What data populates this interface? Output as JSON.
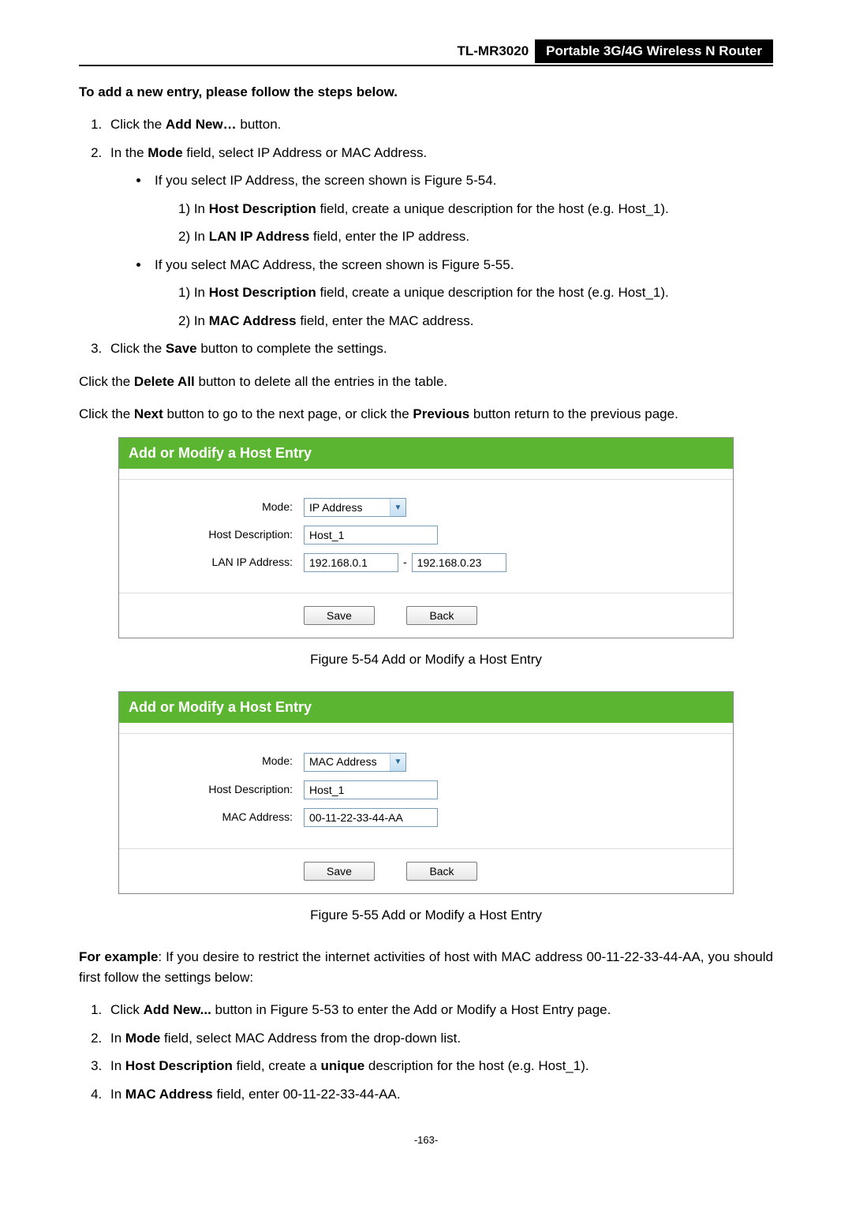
{
  "header": {
    "model": "TL-MR3020",
    "product": "Portable 3G/4G Wireless N Router"
  },
  "intro": "To add a new entry, please follow the steps below.",
  "step1_a": "Click the ",
  "step1_b": "Add New…",
  "step1_c": " button.",
  "step2_a": "In the ",
  "step2_b": "Mode",
  "step2_c": " field, select IP Address or MAC Address.",
  "bullet_ip": "If you select IP Address, the screen shown is Figure 5-54.",
  "ip_1a": "1)  In ",
  "ip_1b": "Host Description",
  "ip_1c": " field, create a unique description for the host (e.g. Host_1).",
  "ip_2a": "2)  In ",
  "ip_2b": "LAN IP Address",
  "ip_2c": " field, enter the IP address.",
  "bullet_mac": "If you select MAC Address, the screen shown is Figure 5-55.",
  "mac_1a": "1)  In ",
  "mac_1b": "Host Description",
  "mac_1c": " field, create a unique description for the host (e.g. Host_1).",
  "mac_2a": "2)  In ",
  "mac_2b": "MAC Address",
  "mac_2c": " field, enter the MAC address.",
  "step3_a": "Click the ",
  "step3_b": "Save",
  "step3_c": " button to complete the settings.",
  "p_delete_a": "Click the ",
  "p_delete_b": "Delete All",
  "p_delete_c": " button to delete all the entries in the table.",
  "p_next_a": "Click the ",
  "p_next_b": "Next",
  "p_next_c": " button to go to the next page, or click the ",
  "p_next_d": "Previous",
  "p_next_e": " button return to the previous page.",
  "fig54": {
    "title": "Add or Modify a Host Entry",
    "labels": {
      "mode": "Mode:",
      "host": "Host Description:",
      "lan": "LAN IP Address:"
    },
    "mode_value": "IP Address",
    "host_value": "Host_1",
    "ip_start": "192.168.0.1",
    "ip_end": "192.168.0.23",
    "save": "Save",
    "back": "Back",
    "caption": "Figure 5-54    Add or Modify a Host Entry"
  },
  "fig55": {
    "title": "Add or Modify a Host Entry",
    "labels": {
      "mode": "Mode:",
      "host": "Host Description:",
      "mac": "MAC Address:"
    },
    "mode_value": "MAC Address",
    "host_value": "Host_1",
    "mac_value": "00-11-22-33-44-AA",
    "save": "Save",
    "back": "Back",
    "caption": "Figure 5-55    Add or Modify a Host Entry"
  },
  "example_a": "For example",
  "example_b": ": If you desire to restrict the internet activities of host with MAC address 00-11-22-33-44-AA, you should first follow the settings below:",
  "ex1_a": "Click ",
  "ex1_b": "Add New...",
  "ex1_c": " button in Figure 5-53 to enter the Add or Modify a Host Entry page.",
  "ex2_a": "In ",
  "ex2_b": "Mode",
  "ex2_c": " field, select MAC Address from the drop-down list.",
  "ex3_a": "In ",
  "ex3_b": "Host Description",
  "ex3_c": " field, create a ",
  "ex3_d": "unique",
  "ex3_e": " description for the host (e.g. Host_1).",
  "ex4_a": "In ",
  "ex4_b": "MAC Address",
  "ex4_c": " field, enter 00-11-22-33-44-AA.",
  "page_number": "-163-"
}
